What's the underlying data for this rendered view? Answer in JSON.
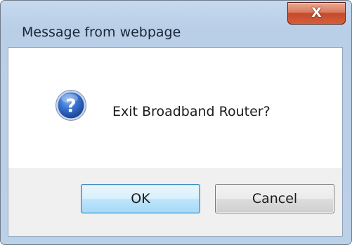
{
  "dialog": {
    "title": "Message from webpage",
    "close_label": "X",
    "close_icon": "close-icon",
    "message": "Exit Broadband Router?",
    "message_icon": "question-icon",
    "buttons": {
      "ok_label": "OK",
      "cancel_label": "Cancel"
    }
  },
  "colors": {
    "close_button_red": "#c44a2a",
    "default_button_blue": "#3c7fb1",
    "question_icon_blue": "#2a5fb8"
  }
}
